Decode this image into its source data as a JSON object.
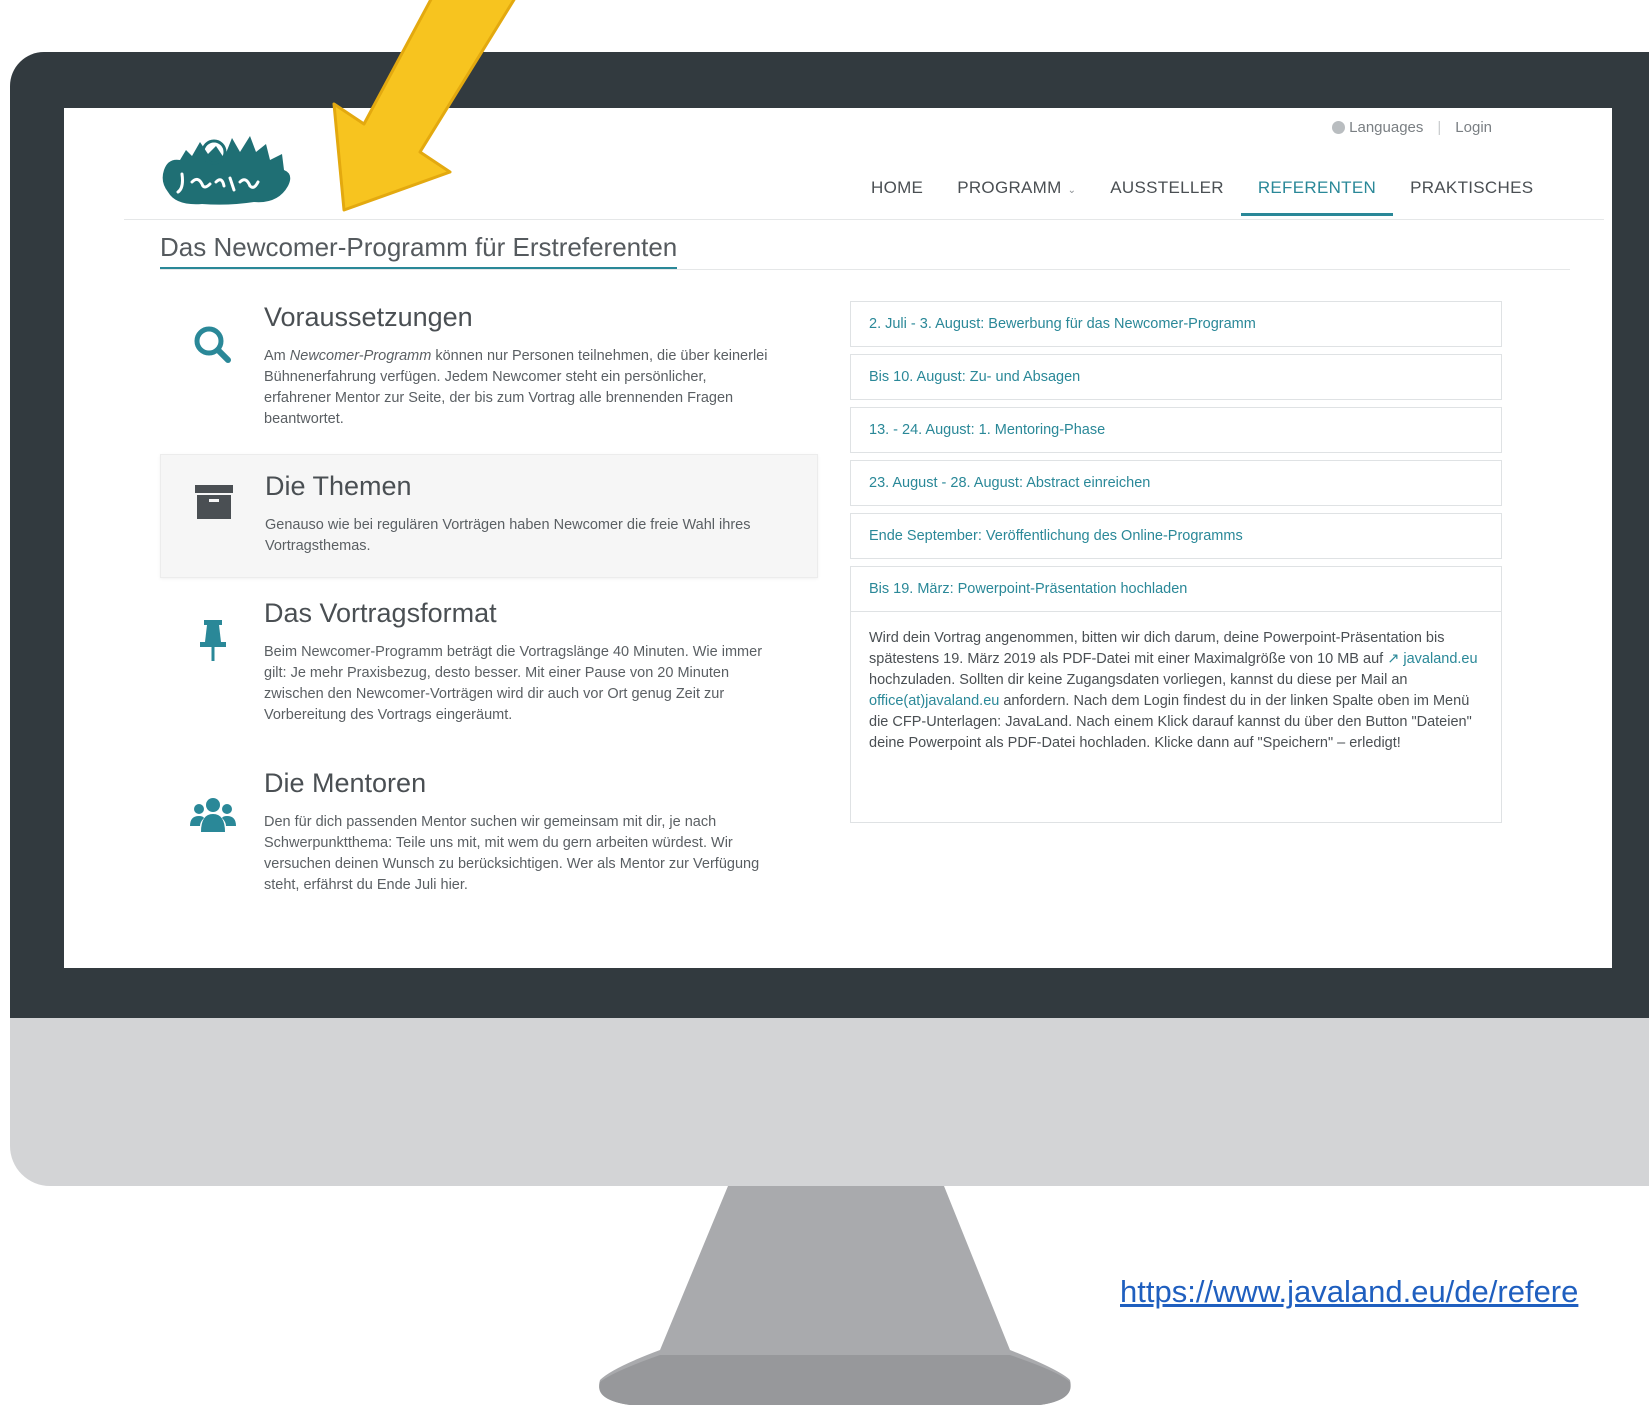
{
  "browser": {
    "url": "https://www.javaland.eu/de/refere"
  },
  "topbar": {
    "languages_label": "Languages",
    "login_label": "Login"
  },
  "nav": {
    "items": [
      {
        "label": "HOME"
      },
      {
        "label": "PROGRAMM",
        "has_dropdown": true
      },
      {
        "label": "AUSSTELLER"
      },
      {
        "label": "REFERENTEN",
        "active": true
      },
      {
        "label": "PRAKTISCHES"
      }
    ]
  },
  "page": {
    "title": "Das Newcomer-Programm für Erstreferenten"
  },
  "features": [
    {
      "icon": "search-icon",
      "title": "Voraussetzungen",
      "text_prefix": "Am ",
      "text_em": "Newcomer-Programm",
      "text_suffix": " können nur Personen teilnehmen, die über keinerlei Bühnenerfahrung verfügen. Jedem Newcomer steht ein persönlicher, erfahrener Mentor zur Seite, der bis zum Vortrag alle brennenden Fragen beantwortet."
    },
    {
      "icon": "archive-box-icon",
      "title": "Die Themen",
      "text": "Genauso wie bei regulären Vorträgen haben Newcomer die freie Wahl ihres Vortragsthemas."
    },
    {
      "icon": "pushpin-icon",
      "title": "Das Vortragsformat",
      "text": "Beim Newcomer-Programm beträgt die Vortragslänge 40 Minuten. Wie immer gilt: Je mehr Praxisbezug, desto besser. Mit einer Pause von 20 Minuten zwischen den Newcomer-Vorträgen wird dir auch vor Ort genug Zeit zur Vorbereitung des Vortrags eingeräumt."
    },
    {
      "icon": "users-group-icon",
      "title": "Die Mentoren",
      "text": "Den für dich passenden Mentor suchen wir gemeinsam mit dir, je nach Schwerpunktthema: Teile uns mit, mit wem du gern arbeiten würdest. Wir versuchen deinen Wunsch zu berücksichtigen. Wer als Mentor zur Verfügung steht, erfährst du Ende Juli hier."
    }
  ],
  "timeline": {
    "items": [
      {
        "label": "2. Juli - 3. August: Bewerbung für das Newcomer-Programm"
      },
      {
        "label": "Bis 10. August: Zu- und Absagen"
      },
      {
        "label": "13. - 24. August: 1. Mentoring-Phase"
      },
      {
        "label": "23. August - 28. August: Abstract einreichen"
      },
      {
        "label": "Ende September: Veröffentlichung des Online-Programms"
      },
      {
        "label": "Bis 19. März: Powerpoint-Präsentation hochladen",
        "expanded": true
      }
    ],
    "panel": {
      "part1": "Wird dein Vortrag angenommen, bitten wir dich darum, deine Powerpoint-Präsentation bis spätestens 19. März 2019 als PDF-Datei mit einer Maximalgröße von 10 MB auf ",
      "link1": "javaland.eu",
      "part2": " hochzuladen. Sollten dir keine Zugangsdaten vorliegen, kannst du diese per Mail an ",
      "link2": "office(at)javaland.eu",
      "part3": " anfordern. Nach dem Login findest du in der linken Spalte oben im Menü die CFP-Unterlagen: JavaLand. Nach einem Klick darauf kannst du über den Button \"Dateien\" deine Powerpoint als PDF-Datei hochladen. Klicke dann auf \"Speichern\" – erledigt!"
    }
  },
  "colors": {
    "accent": "#2a8898",
    "bezel": "#323a3f",
    "chin": "#d3d4d6",
    "arrow": "#f7c41f"
  }
}
